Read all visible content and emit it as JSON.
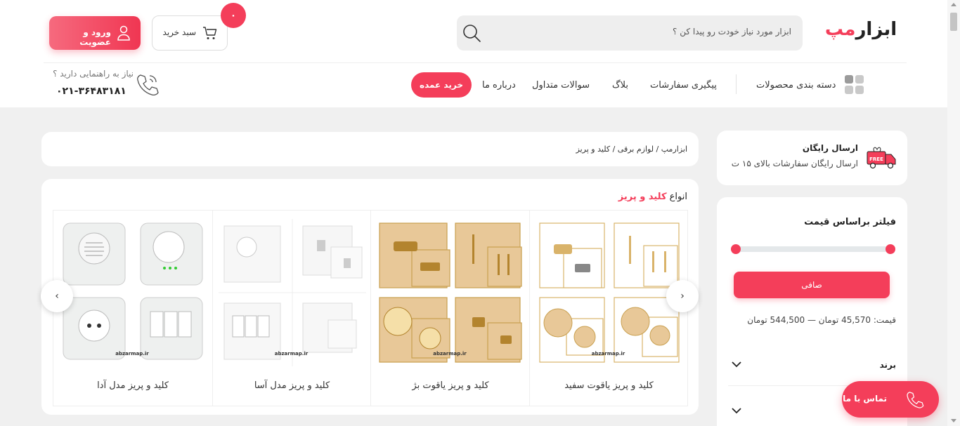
{
  "header": {
    "logo_part1": "ابزار",
    "logo_part2": "مپ",
    "search_placeholder": "ابزار مورد نیاز خودت رو پیدا کن ؟",
    "cart_label": "سبد خرید",
    "cart_count": "۰",
    "login_label": "ورود و عضویت"
  },
  "nav": {
    "categories": "دسته بندی محصولات",
    "tracking": "پیگیری سفارشات",
    "blog": "بلاگ",
    "faq": "سوالات متداول",
    "about": "درباره ما",
    "wholesale": "خرید عمده"
  },
  "help": {
    "text": "نیاز به راهنمایی دارید ؟",
    "phone": "۰۲۱-۳۶۴۸۳۱۸۱"
  },
  "sidebar": {
    "shipping_title": "ارسال رایگان",
    "shipping_sub": "ارسال رایگان سفارشات بالای ۱۵ ت",
    "shipping_badge": "FREE",
    "filter_title": "فیلتر براساس قیمت",
    "filter_min": 0,
    "filter_max": 1,
    "filter_button": "صافی",
    "price_range": "قیمت: 45,570 تومان — 544,500 تومان",
    "brand_label": "برند"
  },
  "breadcrumb": "ابزارمپ / لوازم برقی / کلید و پریز",
  "section": {
    "prefix": "انواع ",
    "highlight": "کلید و پریز"
  },
  "products": [
    {
      "name": "کلید و پریز یاقوت سفید"
    },
    {
      "name": "کلید و پریز یاقوت بژ"
    },
    {
      "name": "کلید و پریز مدل آسا"
    },
    {
      "name": "کلید و پریز مدل آدا"
    }
  ],
  "watermark": "abzarmap.ir",
  "contact_button": "تماس با ما",
  "colors": {
    "accent": "#f43e5a",
    "background": "#f0f0f0",
    "gold": "#d9b36a",
    "beige": "#e8c898"
  }
}
